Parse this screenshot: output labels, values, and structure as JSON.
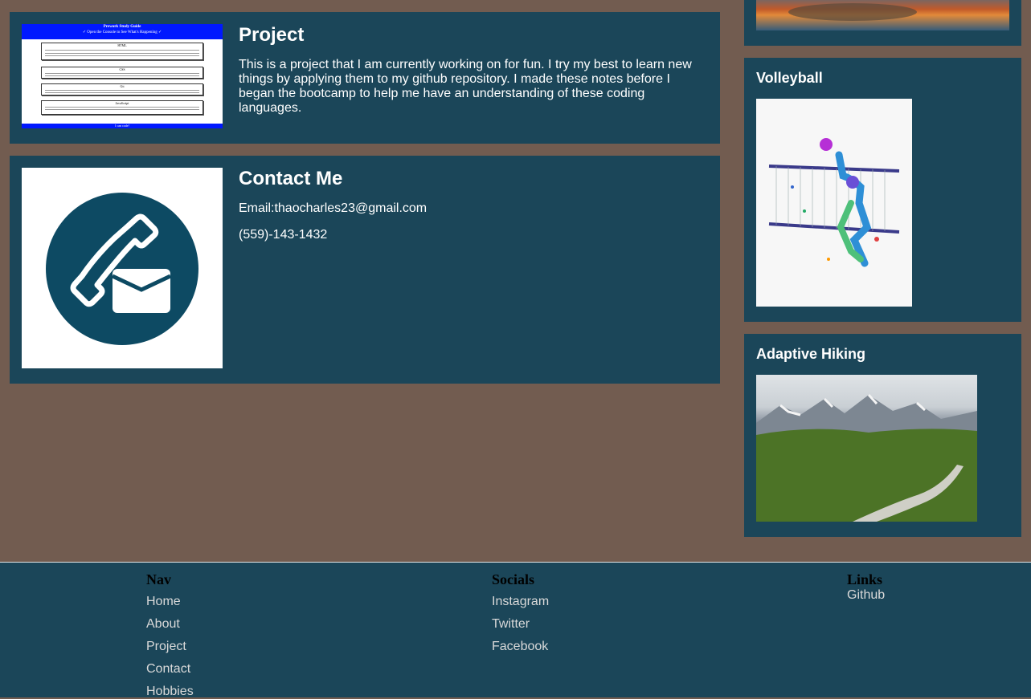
{
  "project": {
    "title": "Project",
    "description": "This is a project that I am currently working on for fun. I try my best to learn new things by applying them to my github repository. I made these notes before I began the bootcamp to help me have an understanding of these coding languages.",
    "thumbnail": {
      "heading": "Prework Study Guide",
      "subheading": "✓ Open the Console to See What's Happening ✓",
      "sections": [
        "HTML",
        "CSS",
        "Git",
        "JavaScript"
      ],
      "footer": "I can code!"
    }
  },
  "contact": {
    "title": "Contact Me",
    "email": "Email:thaocharles23@gmail.com",
    "phone": "(559)-143-1432"
  },
  "hobbies": [
    {
      "title": "Volleyball"
    },
    {
      "title": "Adaptive Hiking"
    }
  ],
  "footer": {
    "nav": {
      "heading": "Nav",
      "links": [
        "Home",
        "About",
        "Project",
        "Contact",
        "Hobbies"
      ]
    },
    "socials": {
      "heading": "Socials",
      "links": [
        "Instagram",
        "Twitter",
        "Facebook"
      ]
    },
    "links": {
      "heading": "Links",
      "links": [
        "Github"
      ]
    }
  },
  "colors": {
    "page_bg": "#725c50",
    "card_bg": "#1b4659",
    "contact_icon": "#0d4a63"
  }
}
